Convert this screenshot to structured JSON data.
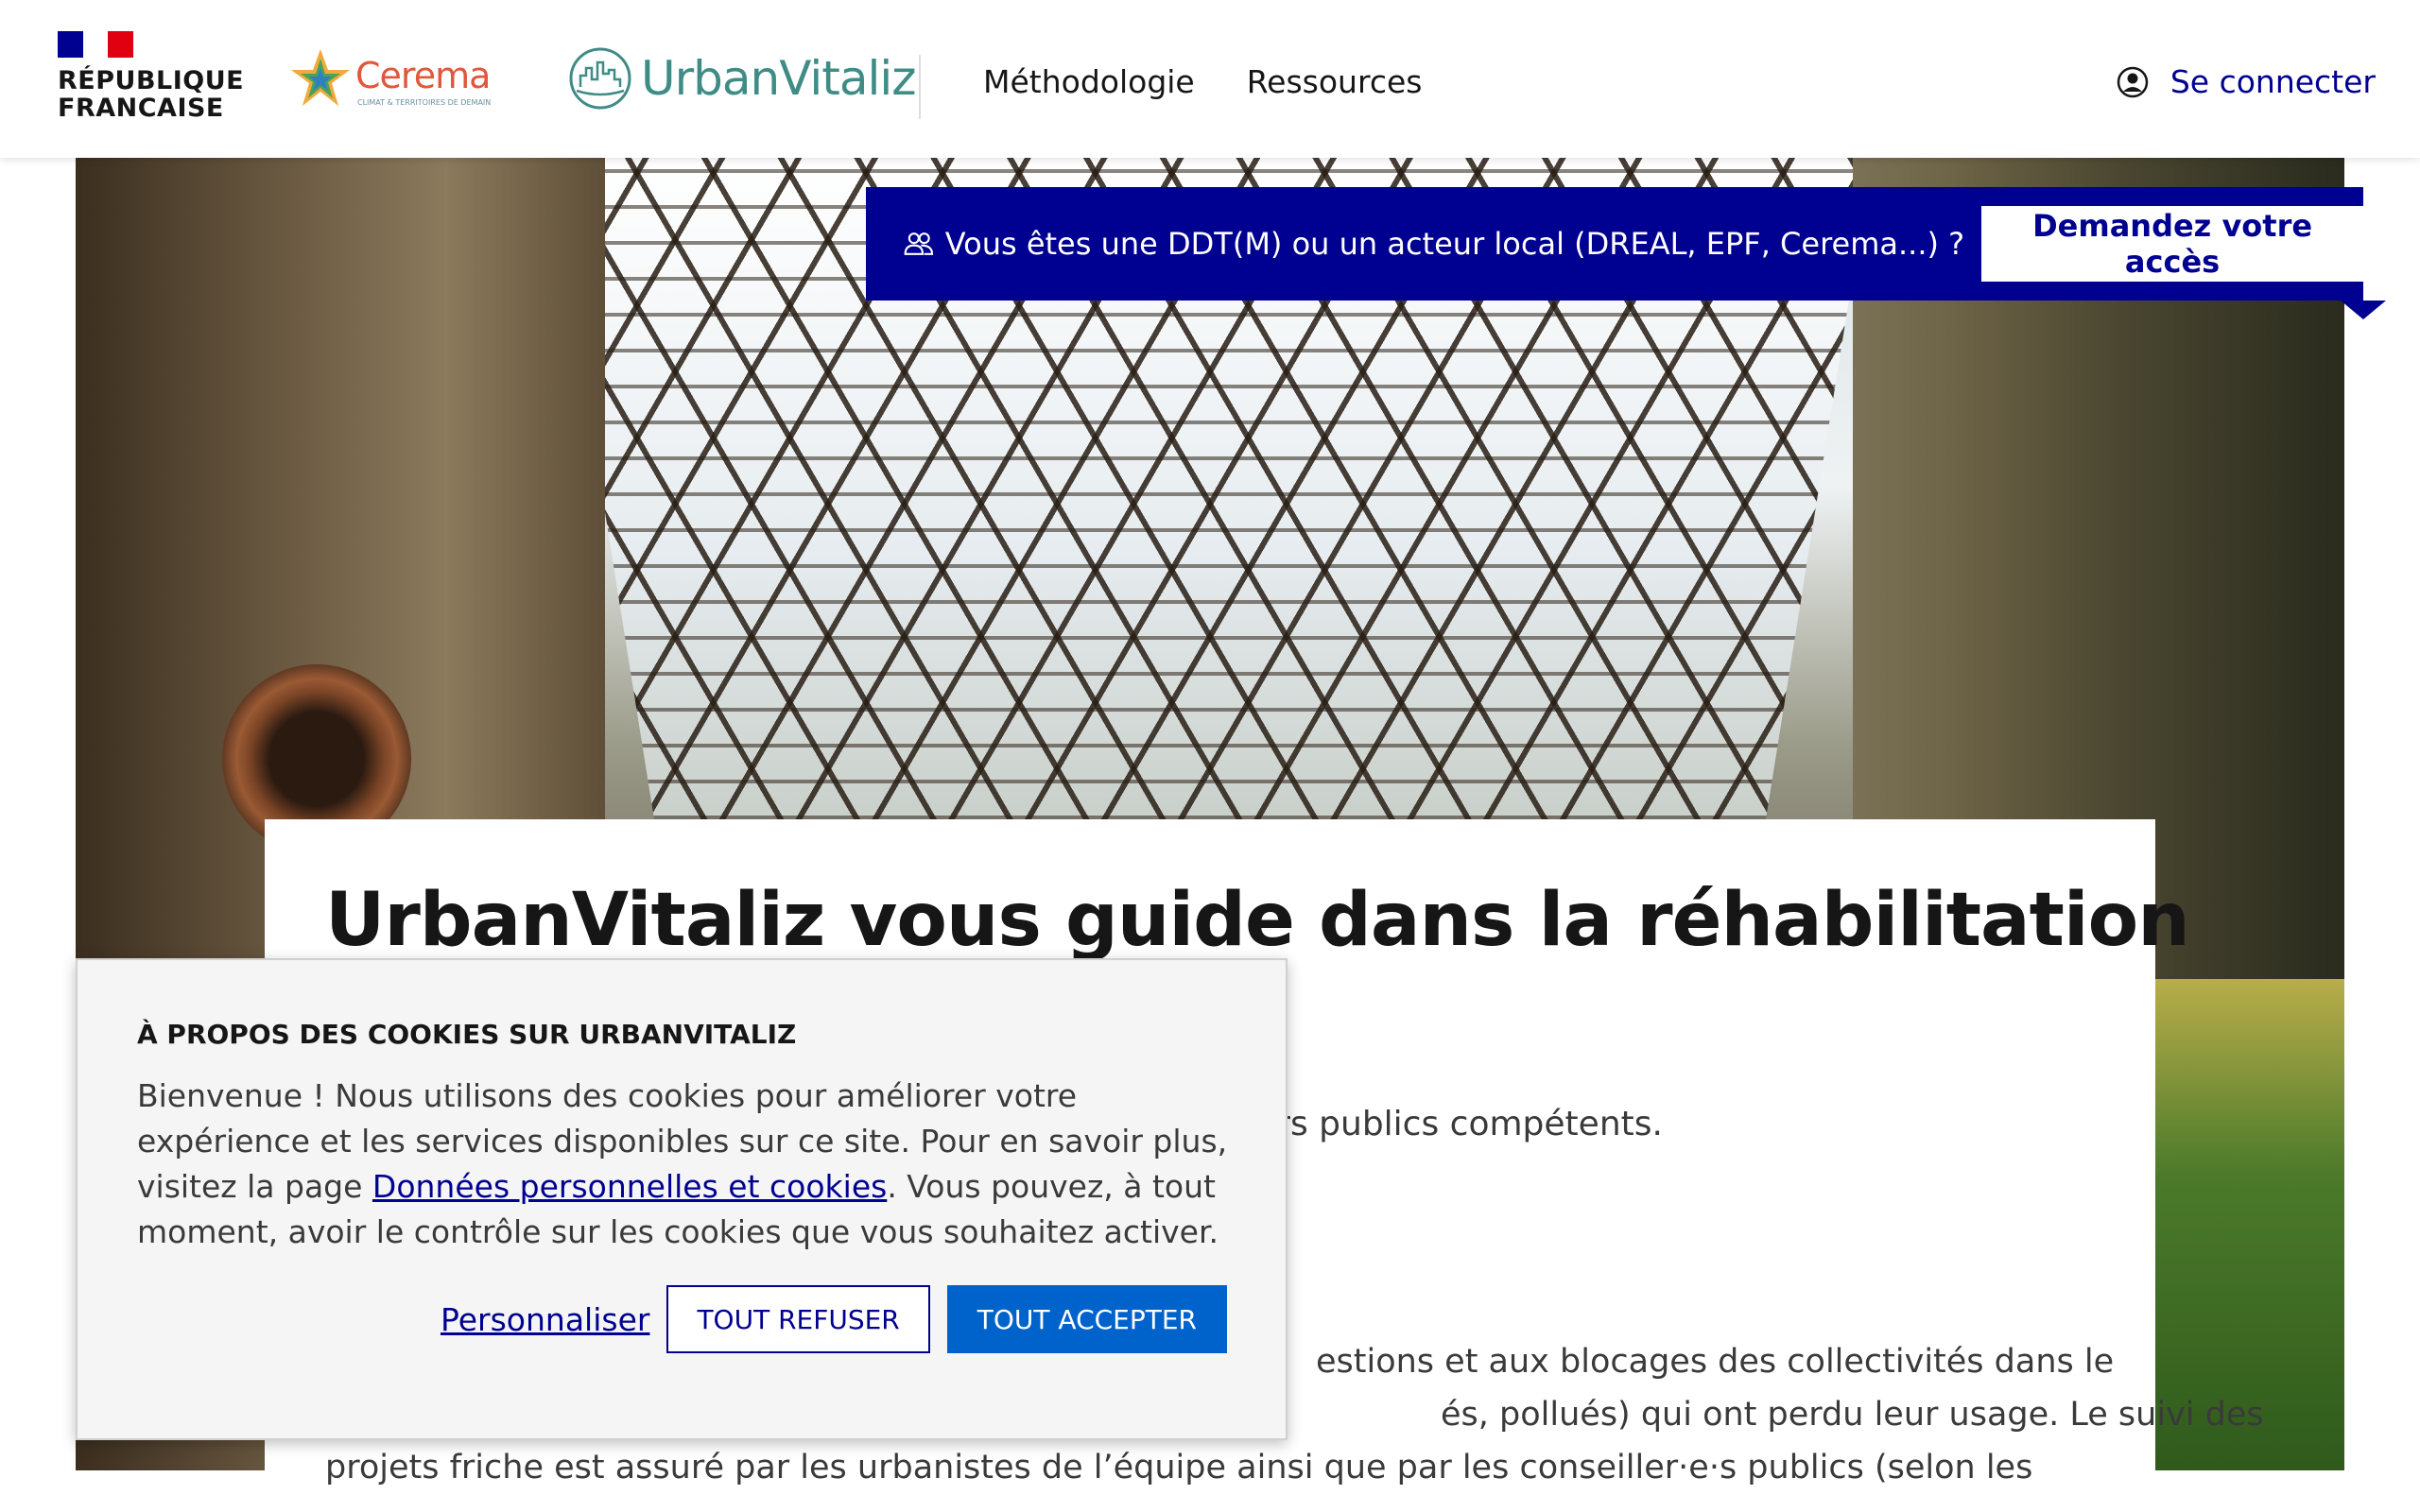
{
  "header": {
    "gov_name": "RÉPUBLIQUE\nFRANCAISE",
    "partner_name": "Cerema",
    "partner_tagline": "CLIMAT & TERRITOIRES DE DEMAIN",
    "brand_name": "UrbanVitaliz",
    "nav": [
      {
        "label": "Méthodologie"
      },
      {
        "label": "Ressources"
      }
    ],
    "login_label": "Se connecter"
  },
  "banner": {
    "text": "Vous êtes une DDT(M) ou un acteur local (DREAL, EPF, Cerema...) ?",
    "button_label": "Demandez votre accès"
  },
  "hero": {
    "title": "UrbanVitaliz vous guide dans la réhabilitation",
    "subtitle_fragment": "llers publics compétents.",
    "paragraph_fragments": [
      "estions et aux blocages des collectivités dans le",
      "és, pollués) qui ont perdu leur usage. Le suivi des",
      "projets friche est assuré par les urbanistes de l’équipe ainsi que par les conseiller·e·s publics (selon les"
    ]
  },
  "cookie": {
    "title": "À PROPOS DES COOKIES SUR URBANVITALIZ",
    "body_before": "Bienvenue ! Nous utilisons des cookies pour améliorer votre expérience et les services disponibles sur ce site. Pour en savoir plus, visitez la page ",
    "link_label": "Données personnelles et cookies",
    "body_after": ". Vous pouvez, à tout moment, avoir le contrôle sur les cookies que vous souhaitez activer.",
    "customize_label": "Personnaliser",
    "refuse_label": "TOUT REFUSER",
    "accept_label": "TOUT ACCEPTER"
  },
  "colors": {
    "brand_blue": "#000091",
    "accept_blue": "#0063cb",
    "marianne_red": "#e1000f",
    "uv_teal": "#3f8c86",
    "cerema_orange": "#e1573a"
  }
}
